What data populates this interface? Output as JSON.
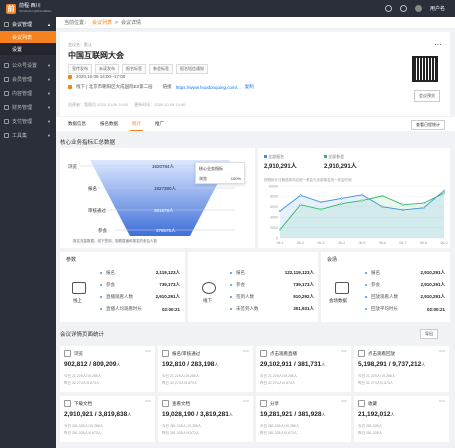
{
  "app": {
    "logo_name": "前程·西川",
    "logo_sub": "SICHUAN QIANCHENG",
    "user": "用户名"
  },
  "sidebar": {
    "groups": [
      {
        "label": "会议管理",
        "active": true
      },
      {
        "label": "公众号设置"
      },
      {
        "label": "会员管理"
      },
      {
        "label": "内容管理"
      },
      {
        "label": "财务管理"
      },
      {
        "label": "支付管理"
      },
      {
        "label": "工具集"
      }
    ],
    "subs": [
      {
        "label": "会议列表"
      },
      {
        "label": "设置"
      }
    ]
  },
  "breadcrumb": {
    "prefix": "当前位置：",
    "link": "会议列表",
    "sep": ">",
    "current": "会议详情"
  },
  "header": {
    "meta": "会议名：默认",
    "title": "中国互联网大会",
    "tags": [
      "宣传发布",
      "未读发布",
      "报名标签",
      "参会标签",
      "报名短信通知"
    ],
    "time": "2020.10.09 14:00--17:00",
    "place": "线下 | 北京市朝阳区大成国际E2第二层",
    "link_label": "链接",
    "link": "https://www.huodonquing.com/...",
    "copy": "复制",
    "foot": [
      "创建者：管理员 2020.10.09 10:00",
      "更新时间：2020.10.09 14:00"
    ],
    "qr_btn": "会议预览"
  },
  "tabs": {
    "items": [
      "数据信息",
      "报名数据",
      "统计",
      "推广"
    ],
    "active": 2,
    "btn": "查看日程统计"
  },
  "funnel": {
    "title": "核心业务指标汇总数据",
    "rows": [
      {
        "label": "浏览",
        "value": "1920784人"
      },
      {
        "label": "报名",
        "value": "1927390人"
      },
      {
        "label": "审核通过",
        "value": "381978人"
      },
      {
        "label": "参会",
        "value": "378575人"
      }
    ],
    "tip_title": "核心业务指标",
    "tip_label": "浏览",
    "tip_val": "100%",
    "note": "报名流量数据，线下签到、观看直播和报名的参会人数"
  },
  "line_legend": [
    {
      "label": "全部报名",
      "value": "2,910,291人"
    },
    {
      "label": "全部参会",
      "value": "2,910,291人"
    }
  ],
  "chart_data": {
    "type": "line",
    "title": "",
    "x": [
      "06-1",
      "06-2",
      "06-3",
      "06-4",
      "06-5",
      "06-6",
      "06-7",
      "06-8",
      "06-9"
    ],
    "ylim": [
      0,
      10000
    ],
    "yticks": [
      0,
      2000,
      4000,
      6000,
      8000,
      10000
    ],
    "series": [
      {
        "name": "全部报名",
        "color": "#3a8ee6",
        "values": [
          5200,
          8200,
          6900,
          7600,
          8300,
          6000,
          5400,
          5800,
          9100
        ]
      },
      {
        "name": "全部参会",
        "color": "#2fb86b",
        "values": [
          1600,
          6400,
          5500,
          6600,
          7200,
          8100,
          6400,
          6700,
          8600
        ]
      }
    ],
    "caption": "按照统计日期选择对应统一参会与全部报名统一参会时间"
  },
  "offline": {
    "title": "参数",
    "center": "线上",
    "rows": [
      {
        "label": "报名",
        "value": "2,119,123人"
      },
      {
        "label": "参会",
        "value": "739,173人"
      },
      {
        "label": "直播观看人数",
        "value": "2,910,291人"
      },
      {
        "label": "直播人均观看时长",
        "value": "02:00:21"
      }
    ]
  },
  "online": {
    "title": "",
    "center": "线下",
    "rows": [
      {
        "label": "报名",
        "value": "122,119,123人"
      },
      {
        "label": "参会",
        "value": "739,173人"
      },
      {
        "label": "签到人数",
        "value": "910,292人"
      },
      {
        "label": "未签到人数",
        "value": "301,931人"
      }
    ]
  },
  "conf": {
    "title": "会场",
    "center": "会场数据",
    "rows": [
      {
        "label": "报名",
        "value": "2,910,291人"
      },
      {
        "label": "参会",
        "value": "2,910,291人"
      },
      {
        "label": "回放观看人数",
        "value": "2,910,291人"
      },
      {
        "label": "回放平均时长",
        "value": "02:00:21"
      }
    ]
  },
  "bottom": {
    "title": "会议详情页面统计",
    "export": "导出",
    "cards": [
      {
        "label": "浏览",
        "value": "902,812 / 809,209",
        "u": "人",
        "s1": "今日 21,229人/19,286人",
        "s2": "昨日 32,274人/9,673人"
      },
      {
        "label": "报名/审核通过",
        "value": "192,810 / 283,198",
        "u": "人",
        "s1": "今日 21,229人/19,286人",
        "s2": "昨日 32,274人/9,673人"
      },
      {
        "label": "点击观看直播",
        "value": "29,102,911 / 381,731",
        "u": "人",
        "s1": "今日 21,229人/19,286人",
        "s2": "昨日 32,274人/9,673人"
      },
      {
        "label": "点击观看回放",
        "value": "5,198,291 / 9,737,212",
        "u": "人",
        "s1": "今日 21,229人/19,286人",
        "s2": "昨日 32,274人/9,673人"
      },
      {
        "label": "下载文档",
        "value": "2,910,921 / 3,819,838",
        "u": "人",
        "s1": "今日 281,028人/19,286人",
        "s2": "昨日 281,028人/9,673人"
      },
      {
        "label": "查看文档",
        "value": "19,028,190 / 3,819,281",
        "u": "人",
        "s1": "今日 281,028人/19,286人",
        "s2": "昨日 281,028人/9,673人"
      },
      {
        "label": "分享",
        "value": "19,281,921 / 381,928",
        "u": "人",
        "s1": "今日 281,028人/19,286人",
        "s2": "昨日 281,028人/9,673人"
      },
      {
        "label": "收藏",
        "value": "21,192,012",
        "u": "人",
        "s1": "今日 281,028人",
        "s2": "昨日 281,028人"
      }
    ]
  }
}
